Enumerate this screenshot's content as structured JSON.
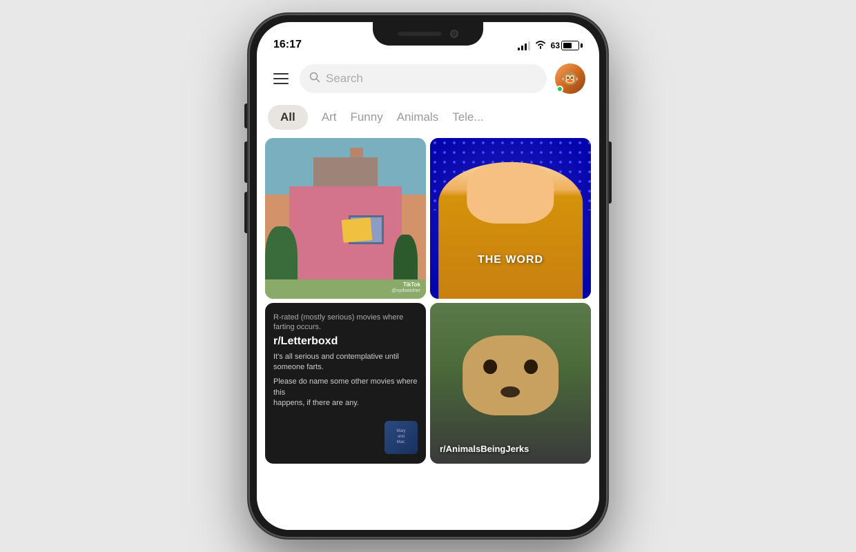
{
  "phone": {
    "time": "16:17",
    "battery_pct": "63"
  },
  "header": {
    "search_placeholder": "Search",
    "menu_label": "Menu"
  },
  "categories": {
    "items": [
      {
        "id": "all",
        "label": "All",
        "active": true
      },
      {
        "id": "art",
        "label": "Art",
        "active": false
      },
      {
        "id": "funny",
        "label": "Funny",
        "active": false
      },
      {
        "id": "animals",
        "label": "Animals",
        "active": false
      },
      {
        "id": "tele",
        "label": "Tele...",
        "active": false
      }
    ]
  },
  "cards": [
    {
      "id": "card-1",
      "type": "tiktok",
      "watermark_app": "TikTok",
      "watermark_user": "@sydswisher"
    },
    {
      "id": "card-2",
      "type": "video",
      "overlay_text": "THE WORD"
    },
    {
      "id": "card-3",
      "type": "reddit",
      "title_line1": "R-rated (mostly serious) movies where",
      "title_line2": "farting occurs.",
      "subreddit": "r/Letterboxd",
      "body_line1": "It's all serious and contemplative until someone farts.",
      "body_line2": "",
      "question": "Please do name some other movies where this",
      "question2": "happens, if there are any.",
      "poster_label": "Mary\nand\nMax."
    },
    {
      "id": "card-4",
      "type": "reddit",
      "subreddit": "r/AnimalsBeingJerks"
    }
  ]
}
